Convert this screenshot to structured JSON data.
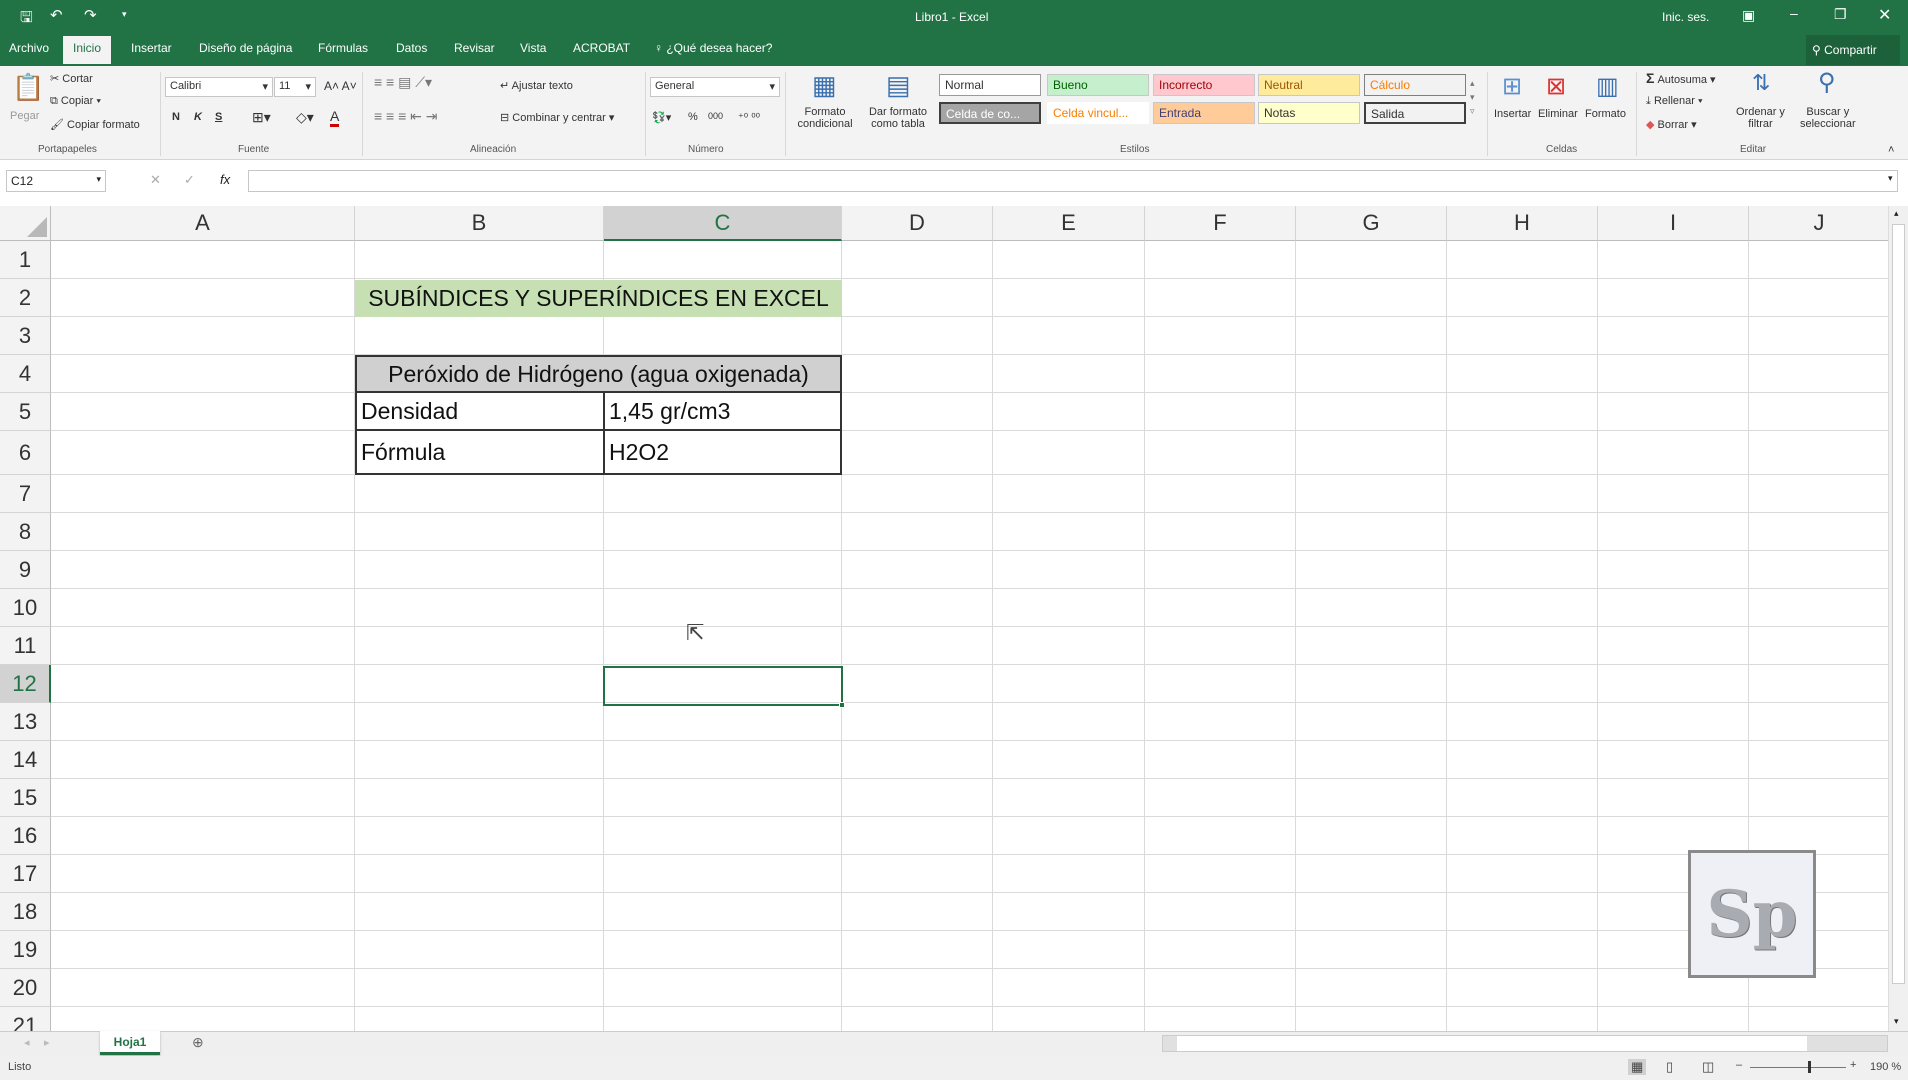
{
  "titlebar": {
    "title": "Libro1 - Excel",
    "signin": "Inic. ses.",
    "qat": [
      "save-icon",
      "undo-icon",
      "redo-icon",
      "customize-icon"
    ]
  },
  "tabs": [
    "Archivo",
    "Inicio",
    "Insertar",
    "Diseño de página",
    "Fórmulas",
    "Datos",
    "Revisar",
    "Vista",
    "ACROBAT"
  ],
  "tell_me": "¿Qué desea hacer?",
  "share": "Compartir",
  "ribbon": {
    "clipboard": {
      "paste": "Pegar",
      "cut": "Cortar",
      "copy": "Copiar",
      "format_painter": "Copiar formato",
      "group": "Portapapeles"
    },
    "font": {
      "name": "Calibri",
      "size": "11",
      "bold": "N",
      "italic": "K",
      "underline": "S",
      "group": "Fuente"
    },
    "alignment": {
      "wrap": "Ajustar texto",
      "merge": "Combinar y centrar",
      "group": "Alineación"
    },
    "number": {
      "format": "General",
      "percent": "%",
      "thousands": "000",
      "group": "Número"
    },
    "styles": {
      "cond_format": [
        "Formato",
        "condicional"
      ],
      "table_format": [
        "Dar formato",
        "como tabla"
      ],
      "cells": [
        "Normal",
        "Bueno",
        "Incorrecto",
        "Neutral",
        "Cálculo",
        "Celda de co...",
        "Celda vincul...",
        "Entrada",
        "Notas",
        "Salida"
      ],
      "group": "Estilos"
    },
    "cells": {
      "insert": "Insertar",
      "delete": "Eliminar",
      "format": "Formato",
      "group": "Celdas"
    },
    "editing": {
      "autosum": "Autosuma",
      "fill": "Rellenar",
      "clear": "Borrar",
      "sort": [
        "Ordenar y",
        "filtrar"
      ],
      "find": [
        "Buscar y",
        "seleccionar"
      ],
      "group": "Editar"
    }
  },
  "formula_bar": {
    "name_box": "C12",
    "fx": "fx",
    "value": ""
  },
  "columns": [
    "A",
    "B",
    "C",
    "D",
    "E",
    "F",
    "G",
    "H",
    "I",
    "J"
  ],
  "rows": [
    "1",
    "2",
    "3",
    "4",
    "5",
    "6",
    "7",
    "8",
    "9",
    "10",
    "11",
    "12",
    "13",
    "14",
    "15",
    "16",
    "17",
    "18",
    "19",
    "20",
    "21"
  ],
  "selected_cell": "C12",
  "cells": {
    "title": "SUBÍNDICES Y SUPERÍNDICES EN EXCEL",
    "header": "Peróxido de Hidrógeno (agua oxigenada)",
    "b5": "Densidad",
    "c5": "1,45 gr/cm3",
    "b6": "Fórmula",
    "c6": "H2O2"
  },
  "watermark": "Sp",
  "sheet_tabs": [
    "Hoja1"
  ],
  "status": {
    "text": "Listo",
    "zoom": "190 %"
  }
}
